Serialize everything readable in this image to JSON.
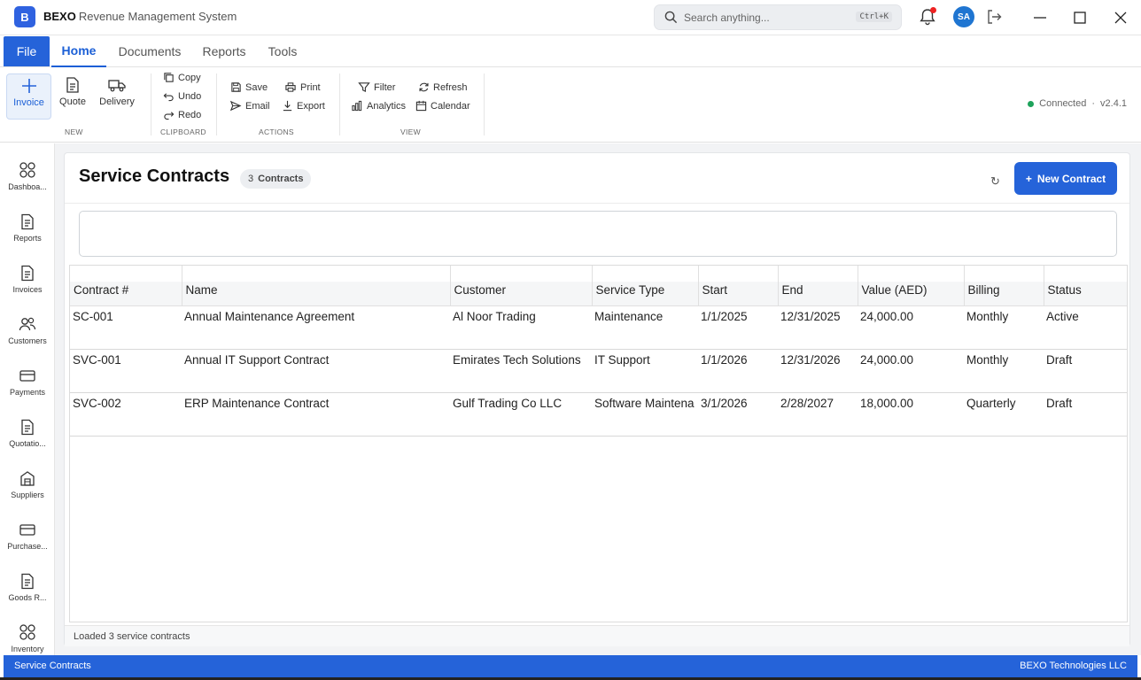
{
  "app": {
    "logo_letter": "B",
    "brand": "BEXO",
    "title": "Revenue Management System",
    "search_placeholder": "Search anything...",
    "search_shortcut": "Ctrl+K",
    "avatar_initials": "SA"
  },
  "menu": {
    "file": "File",
    "tabs": [
      {
        "label": "Home",
        "active": true
      },
      {
        "label": "Documents",
        "active": false
      },
      {
        "label": "Reports",
        "active": false
      },
      {
        "label": "Tools",
        "active": false
      }
    ]
  },
  "ribbon": {
    "new_group": "NEW",
    "invoice": "Invoice",
    "quote": "Quote",
    "delivery": "Delivery",
    "clipboard_group": "CLIPBOARD",
    "copy": "Copy",
    "undo": "Undo",
    "redo": "Redo",
    "actions_group": "ACTIONS",
    "save": "Save",
    "print": "Print",
    "email": "Email",
    "export": "Export",
    "view_group": "VIEW",
    "filter": "Filter",
    "refresh": "Refresh",
    "analytics": "Analytics",
    "calendar": "Calendar",
    "connection_status": "Connected",
    "version": "v2.4.1"
  },
  "sidebar": {
    "items": [
      {
        "label": "Dashboa...",
        "icon": "dashboard-icon"
      },
      {
        "label": "Reports",
        "icon": "document-icon"
      },
      {
        "label": "Invoices",
        "icon": "document-icon"
      },
      {
        "label": "Customers",
        "icon": "people-icon"
      },
      {
        "label": "Payments",
        "icon": "card-icon"
      },
      {
        "label": "Quotatio...",
        "icon": "document-icon"
      },
      {
        "label": "Suppliers",
        "icon": "warehouse-icon"
      },
      {
        "label": "Purchase...",
        "icon": "card-icon"
      },
      {
        "label": "Goods R...",
        "icon": "document-icon"
      },
      {
        "label": "Inventory",
        "icon": "dashboard-icon"
      }
    ]
  },
  "page": {
    "title": "Service Contracts",
    "count": "3",
    "count_label": "Contracts",
    "new_button": "New Contract",
    "status_text": "Loaded 3 service contracts"
  },
  "table": {
    "columns": [
      "Contract #",
      "Name",
      "Customer",
      "Service Type",
      "Start",
      "End",
      "Value (AED)",
      "Billing",
      "Status"
    ],
    "rows": [
      [
        "SC-001",
        "Annual Maintenance Agreement",
        "Al Noor Trading",
        "Maintenance",
        "1/1/2025",
        "12/31/2025",
        "24,000.00",
        "Monthly",
        "Active"
      ],
      [
        "SVC-001",
        "Annual IT Support Contract",
        "Emirates Tech Solutions",
        "IT Support",
        "1/1/2026",
        "12/31/2026",
        "24,000.00",
        "Monthly",
        "Draft"
      ],
      [
        "SVC-002",
        "ERP Maintenance Contract",
        "Gulf Trading Co LLC",
        "Software Maintena",
        "3/1/2026",
        "2/28/2027",
        "18,000.00",
        "Quarterly",
        "Draft"
      ]
    ]
  },
  "footer": {
    "left": "Service Contracts",
    "right": "BEXO Technologies LLC"
  }
}
